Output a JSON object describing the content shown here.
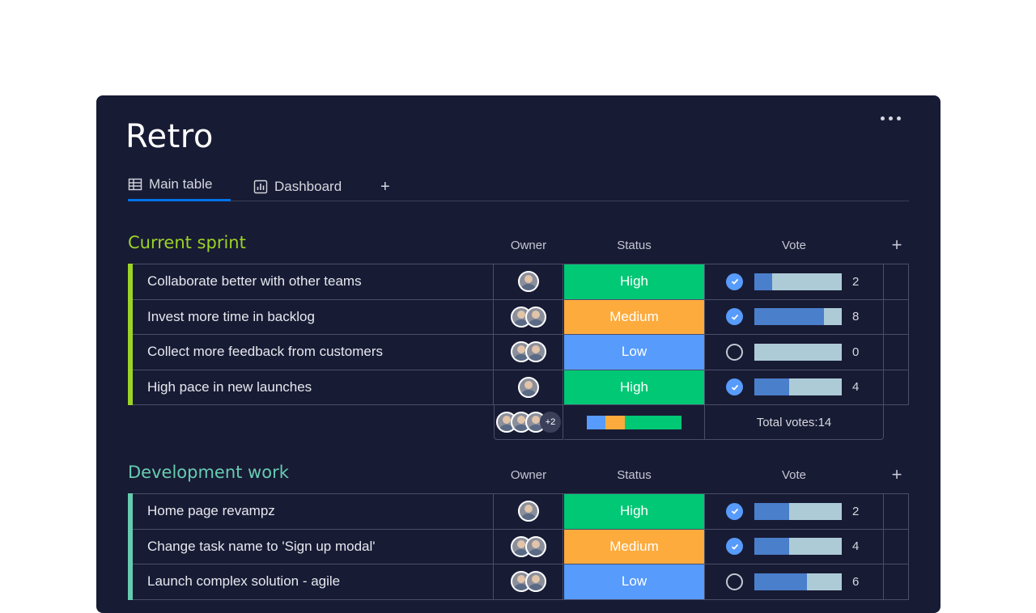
{
  "board": {
    "title": "Retro"
  },
  "tabs": [
    {
      "label": "Main table",
      "icon": "table-icon"
    },
    {
      "label": "Dashboard",
      "icon": "chart-icon"
    }
  ],
  "tab_add": "+",
  "columns": {
    "owner": "Owner",
    "status": "Status",
    "vote": "Vote",
    "add": "+"
  },
  "colors": {
    "high": "#00c875",
    "medium": "#fdab3d",
    "low": "#579bfc",
    "sprint_group": "#9cd326",
    "dev_group": "#66ccb1"
  },
  "groups": [
    {
      "title": "Current sprint",
      "color": "#9cd326",
      "items": [
        {
          "name": "Collaborate better with other teams",
          "status": "High",
          "voted": true,
          "votes": "2",
          "owners": 1,
          "vote_fill": 0.2
        },
        {
          "name": "Invest more time in backlog",
          "status": "Medium",
          "voted": true,
          "votes": "8",
          "owners": 2,
          "vote_fill": 0.8
        },
        {
          "name": "Collect more feedback from customers",
          "status": "Low",
          "voted": false,
          "votes": "0",
          "owners": 2,
          "vote_fill": 0
        },
        {
          "name": "High pace in new launches",
          "status": "High",
          "voted": true,
          "votes": "4",
          "owners": 1,
          "vote_fill": 0.4
        }
      ],
      "summary": {
        "more_owners": "+2",
        "total_votes": "Total votes:14",
        "status_mix": [
          0.2,
          0.2,
          0.6
        ]
      }
    },
    {
      "title": "Development work",
      "color": "#66ccb1",
      "items": [
        {
          "name": "Home page revampz",
          "status": "High",
          "voted": true,
          "votes": "2",
          "owners": 1,
          "vote_fill": 0.4
        },
        {
          "name": "Change task name to 'Sign up modal'",
          "status": "Medium",
          "voted": true,
          "votes": "4",
          "owners": 2,
          "vote_fill": 0.4
        },
        {
          "name": "Launch complex solution - agile",
          "status": "Low",
          "voted": false,
          "votes": "6",
          "owners": 2,
          "vote_fill": 0.6
        }
      ]
    }
  ]
}
